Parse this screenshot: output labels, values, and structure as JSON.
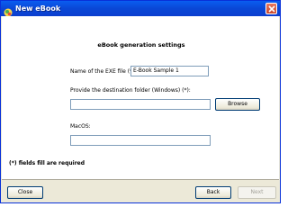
{
  "window": {
    "title": "New eBook",
    "icon": "app-icon",
    "close_icon": "close-icon"
  },
  "form": {
    "heading": "eBook generation settings",
    "exe_name_label": "Name of the EXE file (*):",
    "exe_name_value": "E-Book Sample 1",
    "dest_folder_label": "Provide the destination folder (Windows) (*):",
    "dest_folder_value": "",
    "browse_label": "Browse",
    "macos_label": "MacOS:",
    "macos_value": "",
    "required_note": "(*) fields fill are required"
  },
  "footer": {
    "close_label": "Close",
    "back_label": "Back",
    "next_label": "Next",
    "next_disabled": true
  },
  "colors": {
    "titlebar": "#0a5df0",
    "dialog_bg": "#ece9d8",
    "content_bg": "#ffffff",
    "close_button": "#c9472b"
  }
}
